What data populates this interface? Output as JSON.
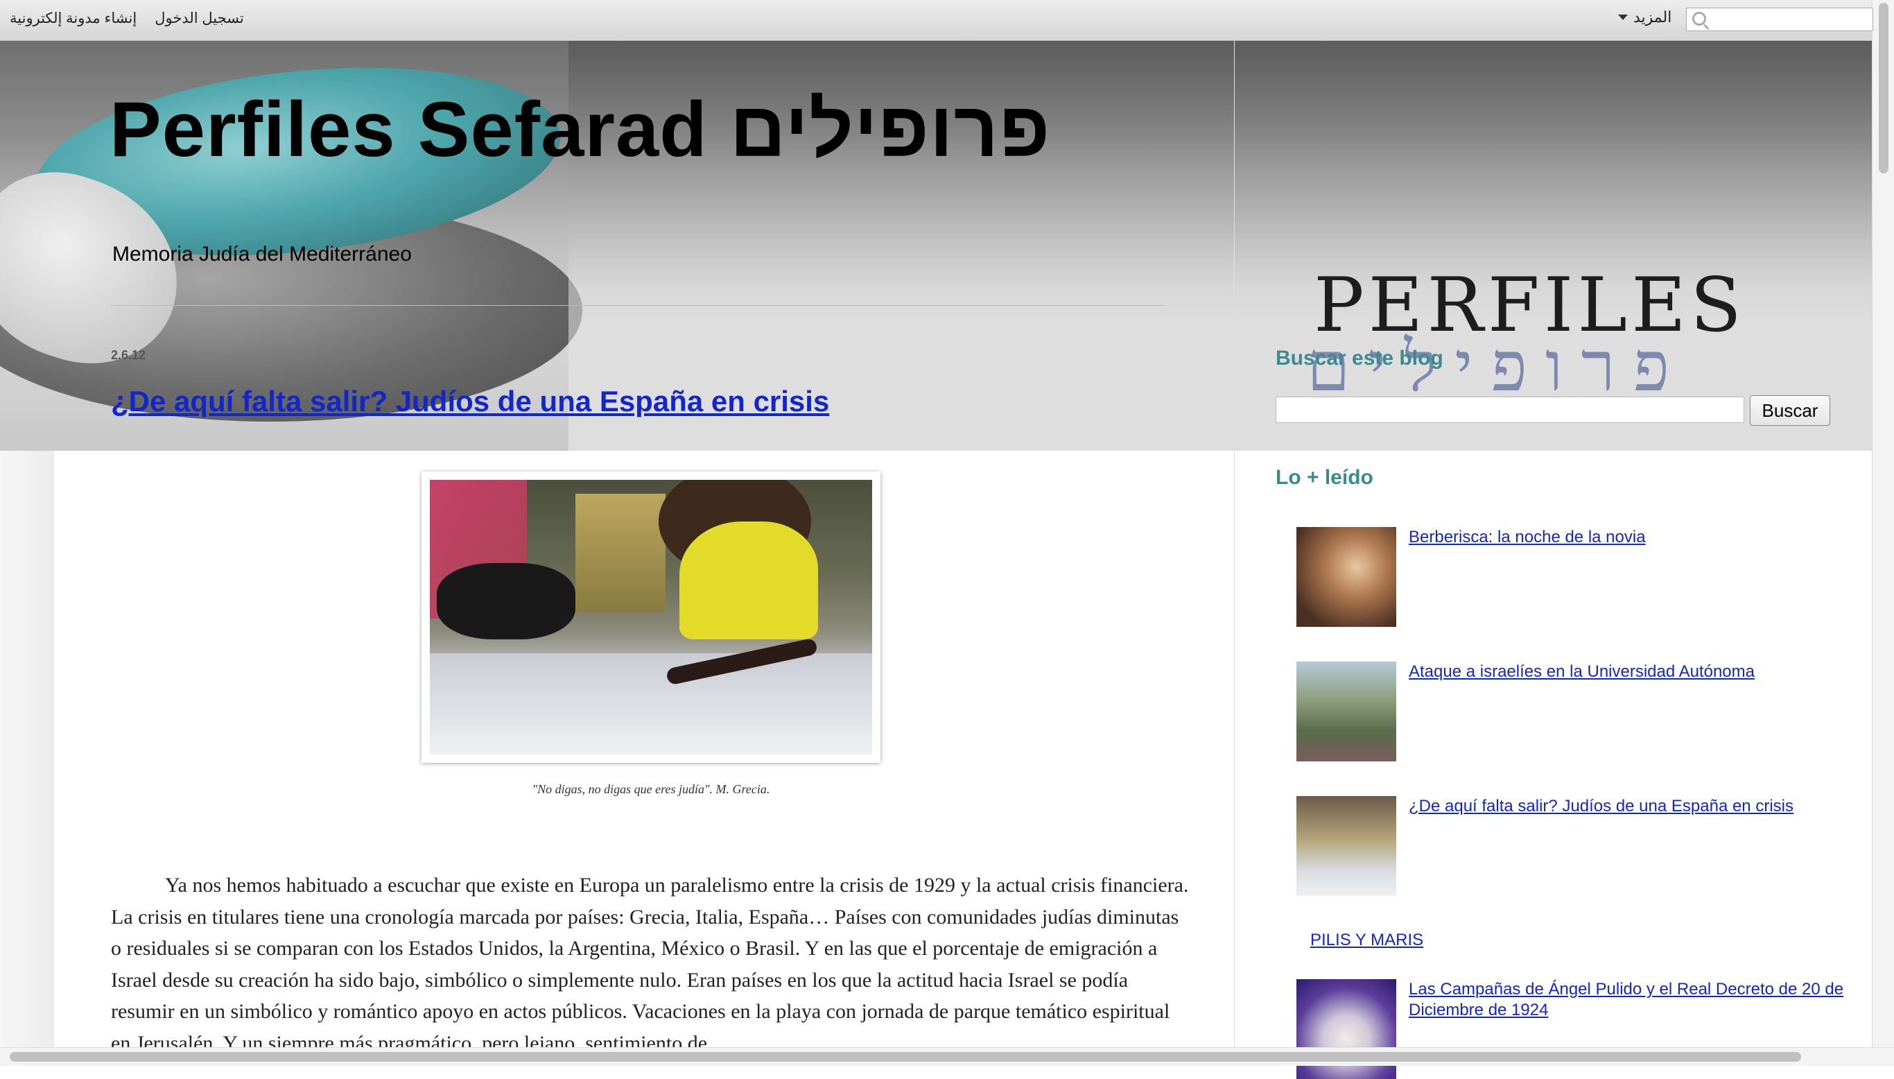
{
  "navbar": {
    "signin_label": "تسجيل الدخول",
    "create_blog_label": "إنشاء مدونة إلكترونية",
    "more_label": "المزيد",
    "search_placeholder": ""
  },
  "header": {
    "title": "Perfiles Sefarad פרופילים",
    "description": "Memoria Judía del Mediterráneo",
    "logo_text": "PERFILES",
    "logo_hebrew": "פרופילים"
  },
  "post": {
    "date": "2.6.12",
    "title": "¿De aquí falta salir? Judíos de una España en crisis",
    "image_caption": "\"No digas, no digas que eres judía\". M. Grecia.",
    "body": "Ya nos hemos habituado a escuchar que existe en Europa un paralelismo entre la crisis de 1929 y la actual crisis financiera. La crisis en titulares tiene una cronología marcada por países: Grecia, Italia, España… Países con comunidades judías diminutas o residuales si se comparan con los Estados Unidos, la Argentina, México o Brasil. Y en las que el porcentaje de emigración a Israel desde su creación ha sido bajo, simbólico o simplemente nulo. Eran países en los que la actitud hacia Israel se podía resumir en un simbólico y romántico apoyo en actos públicos. Vacaciones en la playa con jornada de parque temático espiritual en Jerusalén. Y un siempre más pragmático, pero lejano, sentimiento de"
  },
  "sidebar": {
    "search_title": "Buscar este blog",
    "search_button_label": "Buscar",
    "search_value": "",
    "popular_title": "Lo + leído",
    "popular_posts": [
      {
        "label": "Berberisca: la noche de la novia"
      },
      {
        "label": "Ataque a israelíes en la Universidad Autónoma"
      },
      {
        "label": "¿De aquí falta salir? Judíos de una España en crisis"
      },
      {
        "label": "Las Campañas de Ángel Pulido y el Real Decreto de 20 de Diciembre de 1924"
      }
    ],
    "pilis_label": "PILIS Y MARIS"
  },
  "colors": {
    "link": "#1226c9",
    "sidebar_heading": "#3c8a8e"
  }
}
